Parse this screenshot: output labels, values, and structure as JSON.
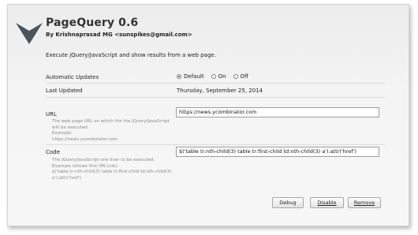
{
  "header": {
    "title": "PageQuery  0.6",
    "author": "By Krishnaprasad MG <sunspikes@gmail.com>"
  },
  "description": "Execute jQuery/JavaScript and show results from a web page.",
  "settings": {
    "auto_updates_label": "Automatic Updates",
    "auto_updates_options": [
      {
        "label": "Default",
        "selected": true
      },
      {
        "label": "On",
        "selected": false
      },
      {
        "label": "Off",
        "selected": false
      }
    ],
    "last_updated_label": "Last Updated",
    "last_updated_value": "Thursday, September 25, 2014"
  },
  "url": {
    "label": "URL",
    "value": "https://news.ycombinator.com",
    "help": [
      "The web page URL on which the the jQuery/JavaScript",
      "will be executed.",
      "Example:",
      "https://news.ycombinator.com"
    ]
  },
  "code": {
    "label": "Code",
    "value": "$('table tr:nth-child(3) table tr:first-child td:nth-child(3) a').attr('href')",
    "help": [
      "The jQuery/JavaScript one liner to be executed.",
      "Example (shows first HN Link):",
      "$('table tr:nth-child(3) table tr:first-child td:nth-child(3)",
      "a').attr('href')"
    ]
  },
  "buttons": {
    "debug": "Debug",
    "disable": "Disable",
    "remove": "Remove"
  },
  "colors": {
    "logo": "#4a5560",
    "panel_bg": "#f2f2f2"
  }
}
